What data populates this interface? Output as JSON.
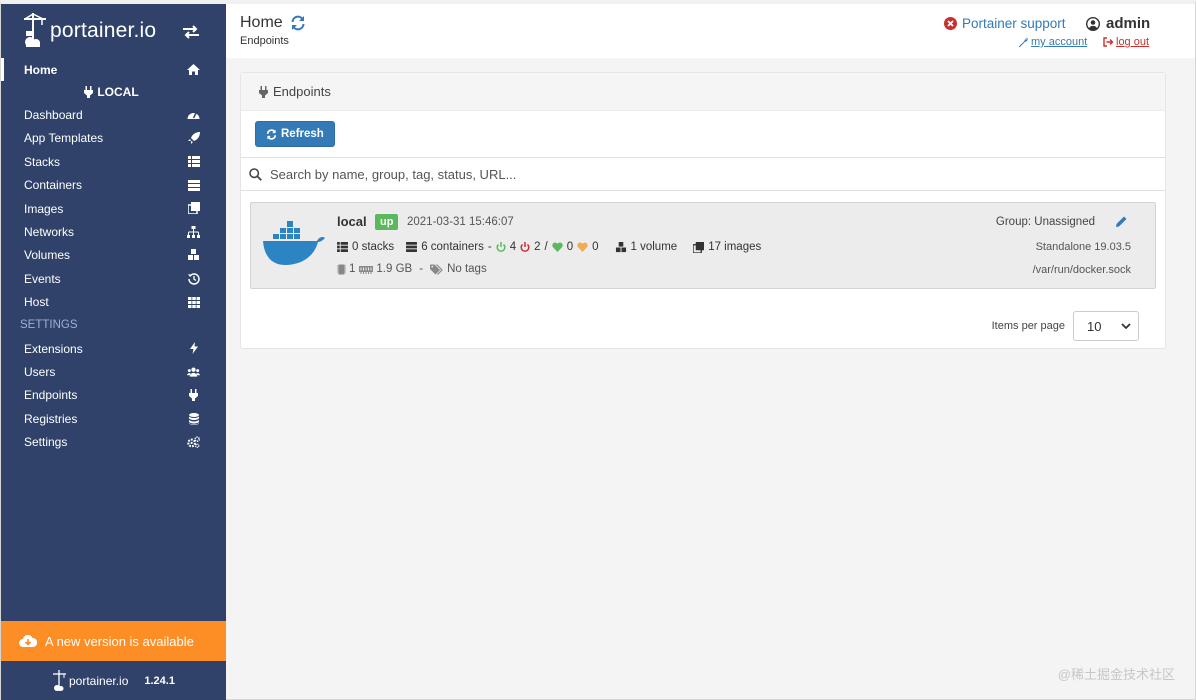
{
  "brand": {
    "text": "portainer.io"
  },
  "sidebar": {
    "home_label": "Home",
    "endpoint_label": "LOCAL",
    "items": [
      {
        "label": "Dashboard",
        "icon": "tachometer-icon"
      },
      {
        "label": "App Templates",
        "icon": "rocket-icon"
      },
      {
        "label": "Stacks",
        "icon": "th-list-icon"
      },
      {
        "label": "Containers",
        "icon": "server-icon"
      },
      {
        "label": "Images",
        "icon": "clone-icon"
      },
      {
        "label": "Networks",
        "icon": "sitemap-icon"
      },
      {
        "label": "Volumes",
        "icon": "cubes-icon"
      },
      {
        "label": "Events",
        "icon": "history-icon"
      },
      {
        "label": "Host",
        "icon": "th-icon"
      }
    ],
    "settings_title": "SETTINGS",
    "settings_items": [
      {
        "label": "Extensions",
        "icon": "bolt-icon"
      },
      {
        "label": "Users",
        "icon": "users-icon"
      },
      {
        "label": "Endpoints",
        "icon": "plug-icon"
      },
      {
        "label": "Registries",
        "icon": "database-icon"
      },
      {
        "label": "Settings",
        "icon": "cogs-icon"
      }
    ],
    "update_banner": "A new version is available",
    "footer_brand": "portainer.io",
    "footer_version": "1.24.1"
  },
  "header": {
    "title": "Home",
    "breadcrumb": "Endpoints",
    "support_label": "Portainer support",
    "username": "admin",
    "my_account": "my account",
    "log_out": "log out"
  },
  "widget": {
    "title": "Endpoints",
    "refresh_label": "Refresh",
    "search_placeholder": "Search by name, group, tag, status, URL..."
  },
  "endpoint": {
    "name": "local",
    "status": "up",
    "timestamp": "2021-03-31 15:46:07",
    "group": "Group: Unassigned",
    "stacks": "0 stacks",
    "containers": "6 containers",
    "running": "4",
    "stopped": "2",
    "healthy": "0",
    "unhealthy": "0",
    "volumes": "1 volume",
    "images": "17 images",
    "version": "Standalone 19.03.5",
    "cpu": "1",
    "memory": "1.9 GB",
    "separator": "-",
    "tags": "No tags",
    "socket": "/var/run/docker.sock"
  },
  "pagination": {
    "label": "Items per page",
    "value": "10"
  },
  "watermark": "@稀土掘金技术社区",
  "colors": {
    "sidebar_bg": "#30426a",
    "accent": "#337ab7",
    "banner": "#fd8d25",
    "status_up": "#5cb85c"
  }
}
